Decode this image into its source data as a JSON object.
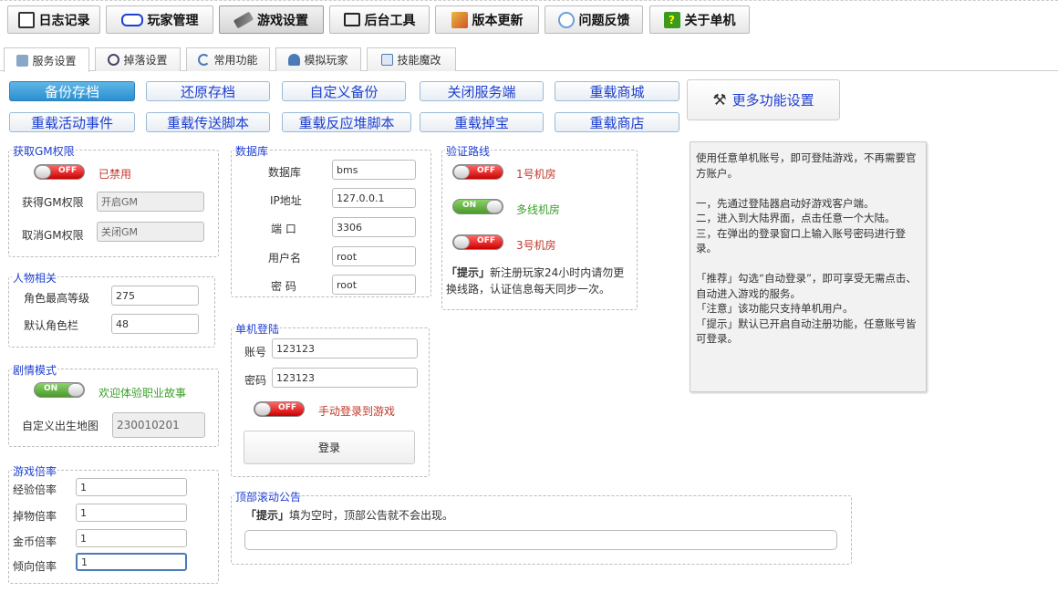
{
  "top_tabs": [
    {
      "label": "日志记录",
      "icon": "notebook-icon"
    },
    {
      "label": "玩家管理",
      "icon": "keyboard-icon"
    },
    {
      "label": "游戏设置",
      "icon": "wrench-icon"
    },
    {
      "label": "后台工具",
      "icon": "monitor-icon"
    },
    {
      "label": "版本更新",
      "icon": "update-icon"
    },
    {
      "label": "问题反馈",
      "icon": "feedback-icon"
    },
    {
      "label": "关于单机",
      "icon": "question-icon"
    }
  ],
  "sub_tabs": [
    {
      "label": "服务设置",
      "icon": "service-icon"
    },
    {
      "label": "掉落设置",
      "icon": "search-icon"
    },
    {
      "label": "常用功能",
      "icon": "refresh-icon"
    },
    {
      "label": "模拟玩家",
      "icon": "user-icon"
    },
    {
      "label": "技能魔改",
      "icon": "skill-icon"
    }
  ],
  "actions": {
    "row1": [
      "备份存档",
      "还原存档",
      "自定义备份",
      "关闭服务端",
      "重载商城"
    ],
    "row2": [
      "重载活动事件",
      "重载传送脚本",
      "重载反应堆脚本",
      "重载掉宝",
      "重载商店"
    ],
    "more": "更多功能设置"
  },
  "gm": {
    "legend": "获取GM权限",
    "toggle": "OFF",
    "status": "已禁用",
    "get_label": "获得GM权限",
    "get_value": "开启GM",
    "cancel_label": "取消GM权限",
    "cancel_value": "关闭GM"
  },
  "character": {
    "legend": "人物相关",
    "max_level_label": "角色最高等级",
    "max_level": "275",
    "slots_label": "默认角色栏",
    "slots": "48"
  },
  "story": {
    "legend": "剧情模式",
    "toggle": "ON",
    "status": "欢迎体验职业故事",
    "map_label": "自定义出生地图",
    "map_value": "230010201"
  },
  "rates": {
    "legend": "游戏倍率",
    "exp_label": "经验倍率",
    "exp": "1",
    "drop_label": "掉物倍率",
    "drop": "1",
    "meso_label": "金币倍率",
    "meso": "1",
    "trend_label": "倾向倍率",
    "trend": "1"
  },
  "database": {
    "legend": "数据库",
    "db_label": "数据库",
    "db": "bms",
    "ip_label": "IP地址",
    "ip": "127.0.0.1",
    "port_label": "端 口",
    "port": "3306",
    "user_label": "用户名",
    "user": "root",
    "pass_label": "密 码",
    "pass": "root"
  },
  "login": {
    "legend": "单机登陆",
    "account_label": "账号",
    "account": "123123",
    "password_label": "密码",
    "password": "123123",
    "toggle": "OFF",
    "manual": "手动登录到游戏",
    "button": "登录"
  },
  "route": {
    "legend": "验证路线",
    "r1_toggle": "OFF",
    "r1": "1号机房",
    "r2_toggle": "ON",
    "r2": "多线机房",
    "r3_toggle": "OFF",
    "r3": "3号机房",
    "tip_bold": "「提示」",
    "tip": "新注册玩家24小时内请勿更换线路，认证信息每天同步一次。"
  },
  "notice": {
    "legend": "顶部滚动公告",
    "tip_bold": "「提示」",
    "tip": "填为空时，顶部公告就不会出现。",
    "value": ""
  },
  "info_text": "使用任意单机账号，即可登陆游戏，不再需要官方账户。\n\n一，先通过登陆器启动好游戏客户端。\n二，进入到大陆界面，点击任意一个大陆。\n三，在弹出的登录窗口上输入账号密码进行登录。\n\n「推荐」勾选“自动登录”，即可享受无需点击、自动进入游戏的服务。\n「注意」该功能只支持单机用户。\n「提示」默认已开启自动注册功能，任意账号皆可登录。",
  "colors": {
    "accent": "#1e3fd0",
    "on": "#4a9a2a",
    "off": "#c00000"
  }
}
